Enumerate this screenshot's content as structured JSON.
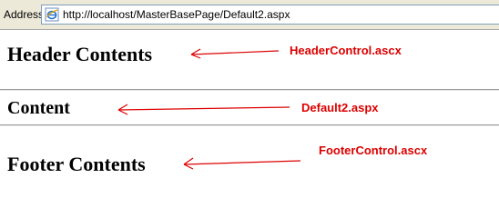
{
  "browser": {
    "address_label": "Address",
    "url": "http://localhost/MasterBasePage/Default2.aspx",
    "address_icon": "ie-page-icon"
  },
  "page": {
    "header_heading": "Header Contents",
    "content_heading": "Content",
    "footer_heading": "Footer Contents"
  },
  "annotations": {
    "header_label": "HeaderControl.ascx",
    "content_label": "Default2.aspx",
    "footer_label": "FooterControl.ascx",
    "color": "#dd0000"
  }
}
